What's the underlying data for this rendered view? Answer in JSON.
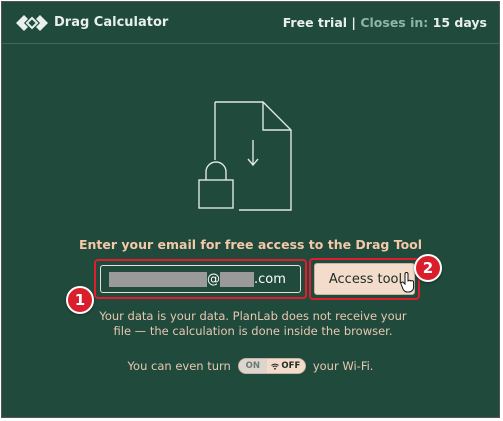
{
  "header": {
    "app_title": "Drag Calculator",
    "trial_label": "Free trial",
    "separator": "|",
    "closes_label": "Closes in:",
    "closes_value": "15 days"
  },
  "main": {
    "headline": "Enter your email for free access to the Drag Tool",
    "email_field": {
      "value_parts": [
        "@",
        ".com"
      ],
      "masked": true
    },
    "access_button_label": "Access tool",
    "privacy_line_1": "Your data is your data. PlanLab does not receive your",
    "privacy_line_2": "file — the calculation is done inside the browser.",
    "wifi_prefix": "You can even turn",
    "wifi_suffix": "your Wi-Fi.",
    "toggle": {
      "on_label": "ON",
      "off_label": "OFF",
      "state": "off"
    }
  },
  "annotations": {
    "step_1": "1",
    "step_2": "2"
  },
  "colors": {
    "background": "#1f4a3c",
    "accent_text": "#f5c8a8",
    "button": "#f3dccb",
    "highlight": "#e11d2d"
  }
}
